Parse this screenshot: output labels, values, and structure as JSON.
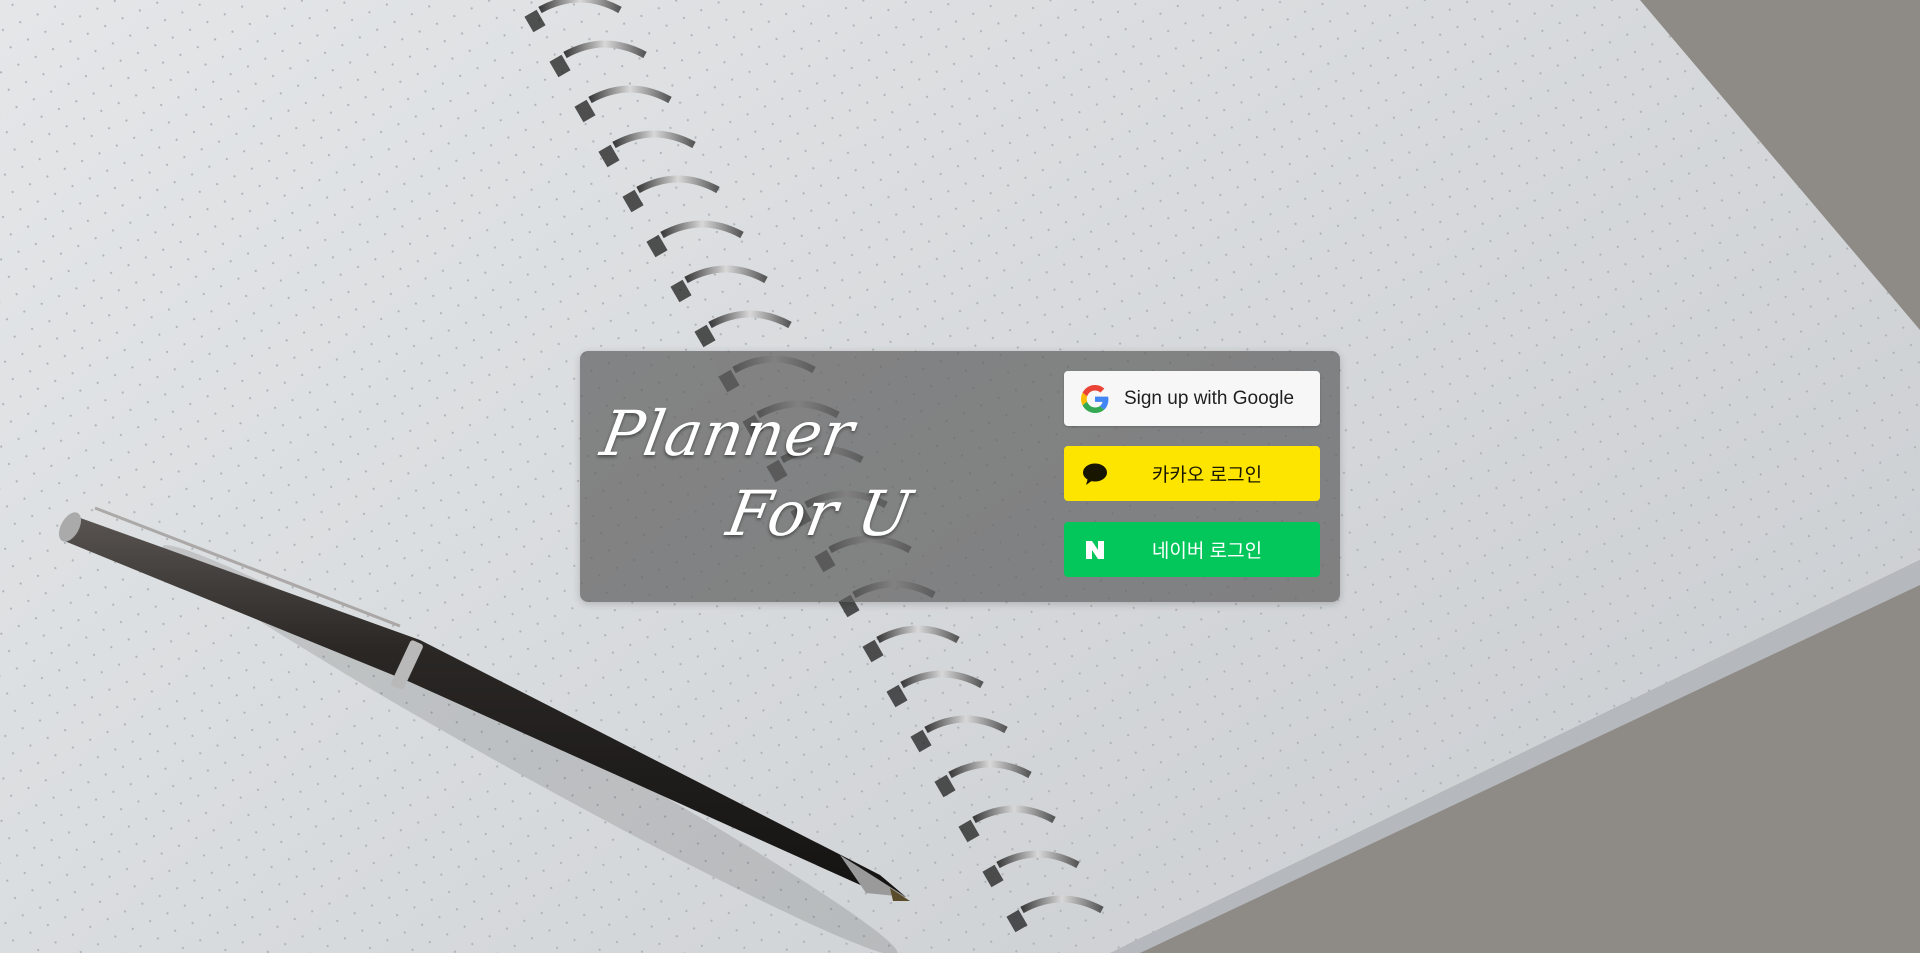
{
  "app": {
    "logo_line_1": "Planner",
    "logo_line_2": "For U"
  },
  "login": {
    "google_label": "Sign up with Google",
    "kakao_label": "카카오 로그인",
    "naver_label": "네이버 로그인"
  },
  "colors": {
    "kakao": "#FEE500",
    "naver": "#03C75A",
    "google_bg": "#F7F7F7",
    "card_overlay": "#5F5F5F"
  },
  "icons": {
    "google": "google-g-icon",
    "kakao": "speech-bubble-icon",
    "naver": "naver-n-icon"
  }
}
